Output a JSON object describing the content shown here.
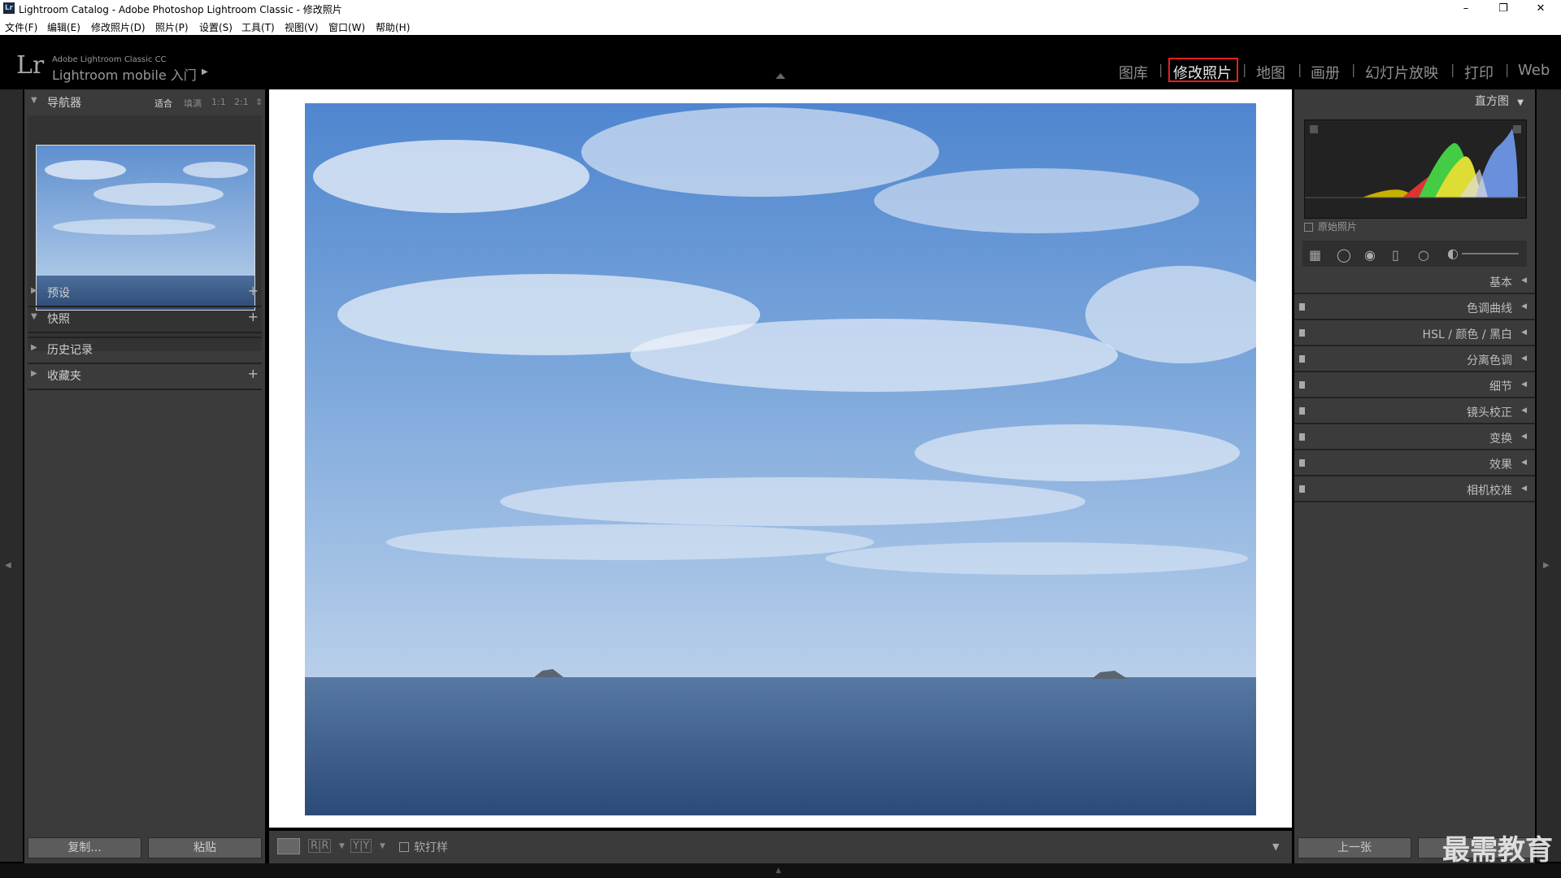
{
  "window": {
    "title": "Lightroom Catalog - Adobe Photoshop Lightroom Classic - 修改照片",
    "app_icon": "Lr",
    "minimize": "–",
    "restore": "❐",
    "close": "✕"
  },
  "menu": [
    "文件(F)",
    "编辑(E)",
    "修改照片(D)",
    "照片(P)",
    "设置(S)",
    "工具(T)",
    "视图(V)",
    "窗口(W)",
    "帮助(H)"
  ],
  "brand": {
    "logo": "Lr",
    "product": "Adobe Lightroom Classic CC",
    "mobile": "Lightroom mobile 入门"
  },
  "modules": [
    {
      "label": "图库",
      "active": false
    },
    {
      "label": "修改照片",
      "active": true
    },
    {
      "label": "地图",
      "active": false
    },
    {
      "label": "画册",
      "active": false
    },
    {
      "label": "幻灯片放映",
      "active": false
    },
    {
      "label": "打印",
      "active": false
    },
    {
      "label": "Web",
      "active": false
    }
  ],
  "left": {
    "navigator": {
      "title": "导航器",
      "zoom": [
        "适合",
        "填满",
        "1:1",
        "2:1"
      ]
    },
    "sections": [
      {
        "label": "预设",
        "expanded": false
      },
      {
        "label": "快照",
        "expanded": true
      },
      {
        "label": "历史记录",
        "expanded": false
      },
      {
        "label": "收藏夹",
        "expanded": false
      }
    ],
    "copy_button": "复制...",
    "paste_button": "粘贴"
  },
  "right": {
    "histogram_title": "直方图",
    "original_photo": "原始照片",
    "sections": [
      "基本",
      "色调曲线",
      "HSL / 颜色 / 黑白",
      "分离色调",
      "细节",
      "镜头校正",
      "变换",
      "效果",
      "相机校准"
    ],
    "prev_button": "上一张"
  },
  "toolbar": {
    "soft_proof": "软打样",
    "compare_ry": "R|R",
    "compare_yy": "Y|Y"
  },
  "watermark": "最需教育"
}
